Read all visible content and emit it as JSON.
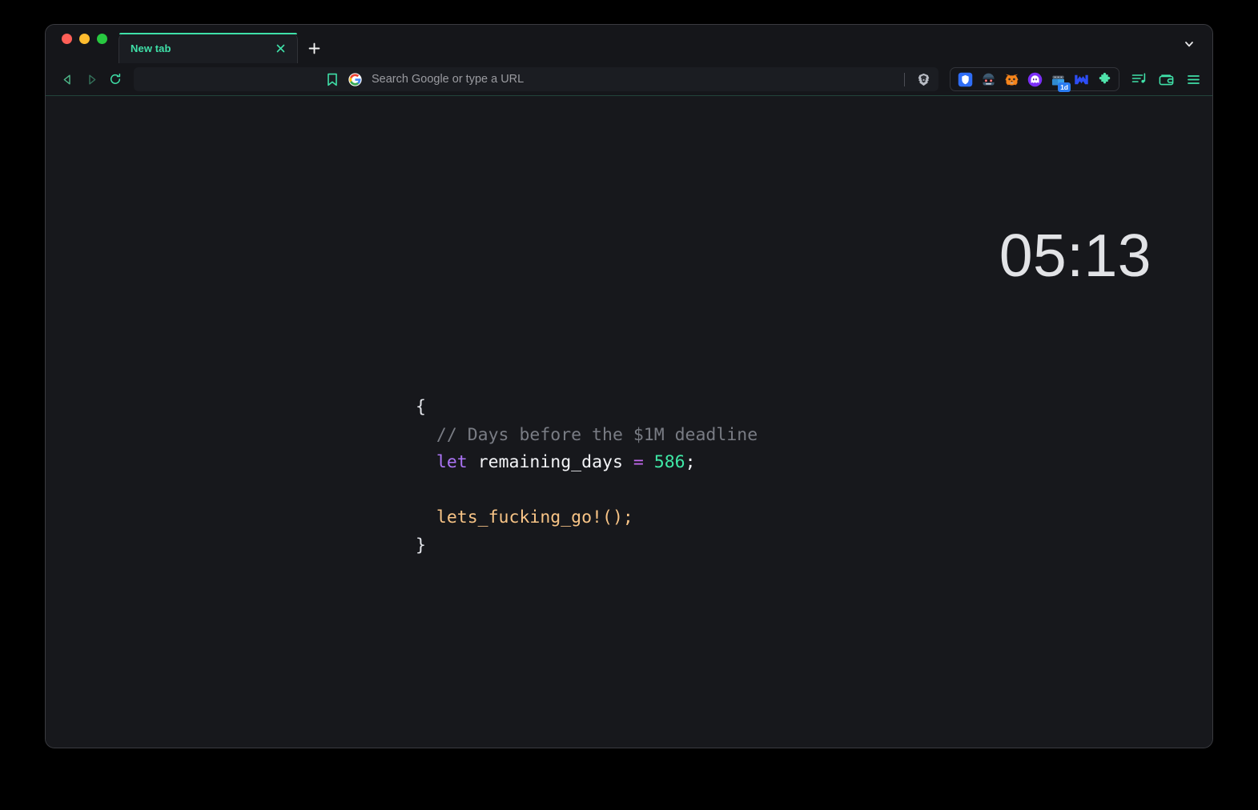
{
  "window": {
    "traffic_lights": [
      {
        "name": "close",
        "color": "#ff5f57"
      },
      {
        "name": "minimize",
        "color": "#febc2e"
      },
      {
        "name": "maximize",
        "color": "#28c840"
      }
    ],
    "accent_color": "#3fe0a8",
    "background": "#17181c"
  },
  "tab_strip": {
    "tabs": [
      {
        "title": "New tab",
        "active": true,
        "close_icon": "close-icon"
      }
    ],
    "new_tab_icon": "plus-icon",
    "overflow_icon": "chevron-down-icon"
  },
  "toolbar": {
    "back_icon": "back-arrow-icon",
    "forward_icon": "forward-arrow-icon",
    "reload_icon": "reload-icon",
    "bookmark_icon": "bookmark-icon",
    "search_engine_icon": "google-g-icon",
    "omnibox_value": "",
    "omnibox_placeholder": "Search Google or type a URL",
    "brave_shield_icon": "brave-lion-icon",
    "extensions": [
      {
        "name": "ublock-origin-shield-icon",
        "badge": ""
      },
      {
        "name": "goggles-avatar-extension-icon",
        "badge": ""
      },
      {
        "name": "metamask-fox-icon",
        "badge": ""
      },
      {
        "name": "phantom-ghost-icon",
        "badge": ""
      },
      {
        "name": "robot-wallet-extension-icon",
        "badge": "1d"
      },
      {
        "name": "backpack-m-icon",
        "badge": ""
      },
      {
        "name": "puzzle-extensions-icon",
        "badge": ""
      }
    ],
    "right_icons": [
      {
        "name": "playlist-icon"
      },
      {
        "name": "wallet-icon"
      },
      {
        "name": "hamburger-menu-icon"
      }
    ]
  },
  "page": {
    "clock": "05:13",
    "code": {
      "lines": [
        {
          "tokens": [
            {
              "text": "{",
              "type": "punct"
            }
          ]
        },
        {
          "tokens": [
            {
              "text": "  ",
              "type": "punct"
            },
            {
              "text": "// Days before the $1M deadline",
              "type": "comment"
            }
          ]
        },
        {
          "tokens": [
            {
              "text": "  ",
              "type": "punct"
            },
            {
              "text": "let",
              "type": "keyword"
            },
            {
              "text": " ",
              "type": "punct"
            },
            {
              "text": "remaining_days",
              "type": "ident"
            },
            {
              "text": " ",
              "type": "punct"
            },
            {
              "text": "=",
              "type": "op"
            },
            {
              "text": " ",
              "type": "punct"
            },
            {
              "text": "586",
              "type": "number"
            },
            {
              "text": ";",
              "type": "ident"
            }
          ]
        },
        {
          "tokens": [
            {
              "text": " ",
              "type": "punct"
            }
          ]
        },
        {
          "tokens": [
            {
              "text": "  ",
              "type": "punct"
            },
            {
              "text": "lets_fucking_go!();",
              "type": "fn"
            }
          ]
        },
        {
          "tokens": [
            {
              "text": "}",
              "type": "punct"
            }
          ]
        }
      ],
      "plain_text": "{\n  // Days before the $1M deadline\n  let remaining_days = 586;\n\n  lets_fucking_go!();\n}",
      "remaining_days_value": "586",
      "deadline_label": "$1M deadline"
    }
  }
}
